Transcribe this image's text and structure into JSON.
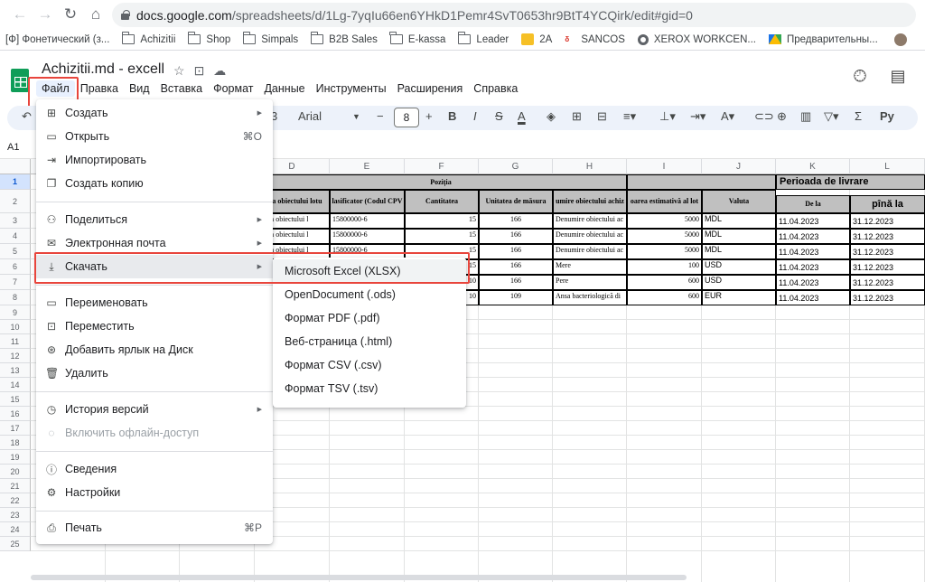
{
  "browser": {
    "url_host": "docs.google.com",
    "url_path": "/spreadsheets/d/1Lg-7yqIu66en6YHkD1Pemr4SvT0653hr9BtT4YCQirk/edit#gid=0",
    "bookmarks": [
      {
        "label": "[Ф] Фонетический (з...",
        "icon": "page-icon"
      },
      {
        "label": "Achizitii",
        "icon": "folder-icon"
      },
      {
        "label": "Shop",
        "icon": "folder-icon"
      },
      {
        "label": "Simpals",
        "icon": "folder-icon"
      },
      {
        "label": "B2B Sales",
        "icon": "folder-icon"
      },
      {
        "label": "E-kassa",
        "icon": "folder-icon"
      },
      {
        "label": "Leader",
        "icon": "folder-icon"
      },
      {
        "label": "2A",
        "icon": "photo-icon"
      },
      {
        "label": "SANCOS",
        "icon": "flame-icon"
      },
      {
        "label": "XEROX WORKCEN...",
        "icon": "globe-icon"
      },
      {
        "label": "Предварительны...",
        "icon": "drive-icon"
      }
    ]
  },
  "doc": {
    "title": "Achizitii.md - excell",
    "menus": [
      "Файл",
      "Правка",
      "Вид",
      "Вставка",
      "Формат",
      "Данные",
      "Инструменты",
      "Расширения",
      "Справка"
    ]
  },
  "toolbar": {
    "zoom_fragment": "3",
    "font": "Arial",
    "font_size": "8",
    "bold": "B",
    "italic": "I",
    "strike": "S",
    "text_color": "A",
    "functions_label": "Ру"
  },
  "name_box": "A1",
  "grid": {
    "columns": [
      "D",
      "E",
      "F",
      "G",
      "H",
      "I",
      "J",
      "K",
      "L"
    ],
    "rows": [
      "1",
      "2",
      "3",
      "4",
      "5",
      "6",
      "7",
      "8",
      "9",
      "10",
      "11",
      "12",
      "13",
      "14",
      "15",
      "16",
      "17",
      "18",
      "19",
      "20",
      "21",
      "22",
      "23",
      "24",
      "25"
    ],
    "header": {
      "pozitia": "Poziția",
      "perioada": "Perioada de livrare",
      "denumirea_lot": "area obiectului lotu",
      "clasificator": "lasificator (Codul CPV",
      "cantitatea": "Cantitatea",
      "unitatea": "Unitatea de măsura",
      "denumire_achiz": "umire obiectului achiz",
      "valoarea": "oarea estimativă al lot",
      "valuta": "Valuta",
      "de_la": "De la",
      "pina_la": "pînă la"
    },
    "data_rows": [
      {
        "d": "rierea obiectului l",
        "e": "15800000-6",
        "f": "15",
        "g": "166",
        "h": "Denumire obiectului ac",
        "i": "5000",
        "j": "MDL",
        "k": "11.04.2023",
        "l": "31.12.2023"
      },
      {
        "d": "rierea obiectului l",
        "e": "15800000-6",
        "f": "15",
        "g": "166",
        "h": "Denumire obiectului ac",
        "i": "5000",
        "j": "MDL",
        "k": "11.04.2023",
        "l": "31.12.2023"
      },
      {
        "d": "rierea obiectului l",
        "e": "15800000-6",
        "f": "15",
        "g": "166",
        "h": "Denumire obiectului ac",
        "i": "5000",
        "j": "MDL",
        "k": "11.04.2023",
        "l": "31.12.2023"
      },
      {
        "d": "",
        "e": "",
        "f": "15",
        "g": "166",
        "h": "Mere",
        "i": "100",
        "j": "USD",
        "k": "11.04.2023",
        "l": "31.12.2023"
      },
      {
        "d": "",
        "e": "",
        "f": "10",
        "g": "166",
        "h": "Pere",
        "i": "600",
        "j": "USD",
        "k": "11.04.2023",
        "l": "31.12.2023"
      },
      {
        "d": "",
        "e": "",
        "f": "10",
        "g": "109",
        "h": "Ansa bacteriologică di",
        "i": "600",
        "j": "EUR",
        "k": "11.04.2023",
        "l": "31.12.2023"
      }
    ]
  },
  "file_menu": {
    "items": [
      {
        "label": "Создать",
        "icon": "plus-box-icon",
        "arrow": true
      },
      {
        "label": "Открыть",
        "icon": "folder-open-icon",
        "shortcut": "⌘O"
      },
      {
        "label": "Импортировать",
        "icon": "import-arrow-icon"
      },
      {
        "label": "Создать копию",
        "icon": "copy-icon"
      },
      {
        "label": "Поделиться",
        "icon": "person-add-icon",
        "arrow": true
      },
      {
        "label": "Электронная почта",
        "icon": "mail-icon",
        "arrow": true
      },
      {
        "label": "Скачать",
        "icon": "download-icon",
        "arrow": true
      },
      {
        "label": "Переименовать",
        "icon": "rename-icon"
      },
      {
        "label": "Переместить",
        "icon": "move-folder-icon"
      },
      {
        "label": "Добавить ярлык на Диск",
        "icon": "drive-shortcut-icon"
      },
      {
        "label": "Удалить",
        "icon": "trash-icon"
      },
      {
        "label": "История версий",
        "icon": "history-icon",
        "arrow": true
      },
      {
        "label": "Включить офлайн-доступ",
        "icon": "offline-icon",
        "disabled": true
      },
      {
        "label": "Сведения",
        "icon": "info-icon"
      },
      {
        "label": "Настройки",
        "icon": "gear-icon"
      },
      {
        "label": "Печать",
        "icon": "print-icon",
        "shortcut": "⌘P"
      }
    ]
  },
  "download_menu": {
    "items": [
      "Microsoft Excel (XLSX)",
      "OpenDocument (.ods)",
      "Формат PDF (.pdf)",
      "Веб-страница (.html)",
      "Формат CSV (.csv)",
      "Формат TSV (.tsv)"
    ]
  },
  "colors": {
    "highlight_border": "#e8453c",
    "sheets_green": "#0f9d58",
    "header_gray": "#c0c0c0"
  }
}
